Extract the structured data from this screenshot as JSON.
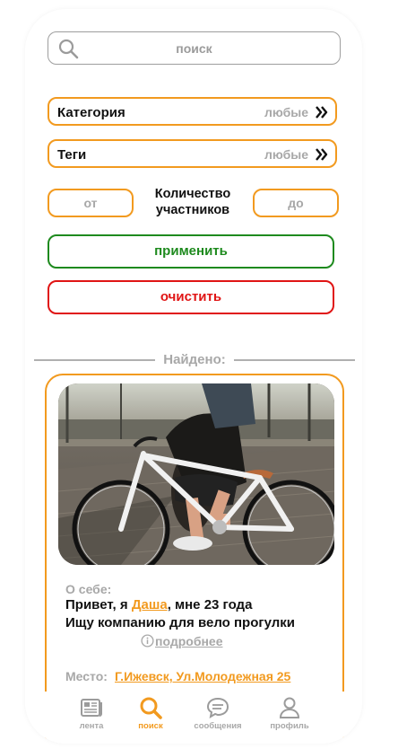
{
  "search": {
    "placeholder": "поиск"
  },
  "filters": {
    "category": {
      "label": "Категория",
      "value": "любые"
    },
    "tags": {
      "label": "Теги",
      "value": "любые"
    }
  },
  "participants": {
    "title": "Количество участников",
    "from_placeholder": "от",
    "to_placeholder": "до"
  },
  "buttons": {
    "apply": "применить",
    "clear": "очистить"
  },
  "results": {
    "found_label": "Найдено:"
  },
  "card": {
    "about_label": "О себе:",
    "greeting_prefix": "Привет, я ",
    "name": "Даша",
    "greeting_suffix": ", мне 23 года",
    "description": "Ищу компанию для вело прогулки",
    "more_label": "подробнее",
    "place_label": "Место:",
    "place_value": "Г.Ижевск, Ул.Молодежная 25"
  },
  "tabbar": {
    "tabs": [
      {
        "label": "лента",
        "icon": "newspaper-icon",
        "active": false
      },
      {
        "label": "поиск",
        "icon": "search-icon",
        "active": true
      },
      {
        "label": "сообщения",
        "icon": "chat-bubble-icon",
        "active": false
      },
      {
        "label": "профиль",
        "icon": "user-icon",
        "active": false
      }
    ]
  },
  "colors": {
    "accent": "#f29a1f",
    "apply": "#1e8a1e",
    "clear": "#e01414",
    "muted": "#a8a8a8",
    "text": "#111111"
  }
}
